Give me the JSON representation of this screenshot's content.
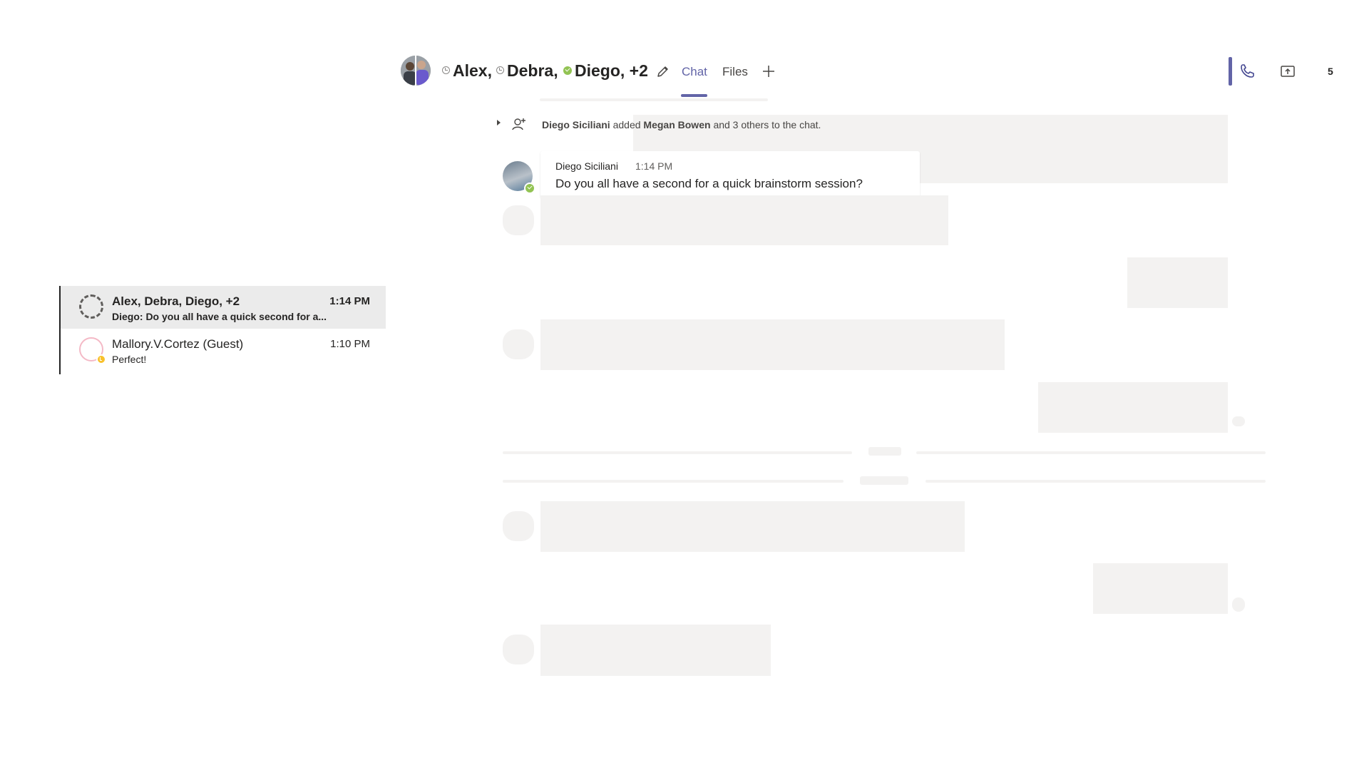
{
  "chat_list": [
    {
      "name": "Alex, Debra, Diego, +2",
      "preview": "Diego: Do you all have a quick second for a...",
      "time": "1:14 PM",
      "selected": true
    },
    {
      "name": "Mallory.V.Cortez (Guest)",
      "preview": "Perfect!",
      "time": "1:10 PM",
      "selected": false
    }
  ],
  "header": {
    "participants": [
      "Alex,",
      "Debra,",
      "Diego, +2"
    ],
    "tabs": [
      "Chat",
      "Files"
    ],
    "participant_count": "5",
    "icons": [
      "edit-icon",
      "add-tab-icon",
      "call-icon",
      "share-screen-icon"
    ]
  },
  "messages": {
    "system": {
      "actor": "Diego Siciliani",
      "verb": "added",
      "target": "Megan Bowen",
      "rest": "and 3 others to the chat."
    },
    "message": {
      "author": "Diego Siciliani",
      "time": "1:14 PM",
      "body": "Do you all have a  second for a quick brainstorm session?"
    }
  },
  "colors": {
    "accent": "#6264a7",
    "online": "#92c353",
    "away_guest": "#f8c12c",
    "skeleton": "#f3f2f1",
    "selected_row": "#ebebeb"
  }
}
